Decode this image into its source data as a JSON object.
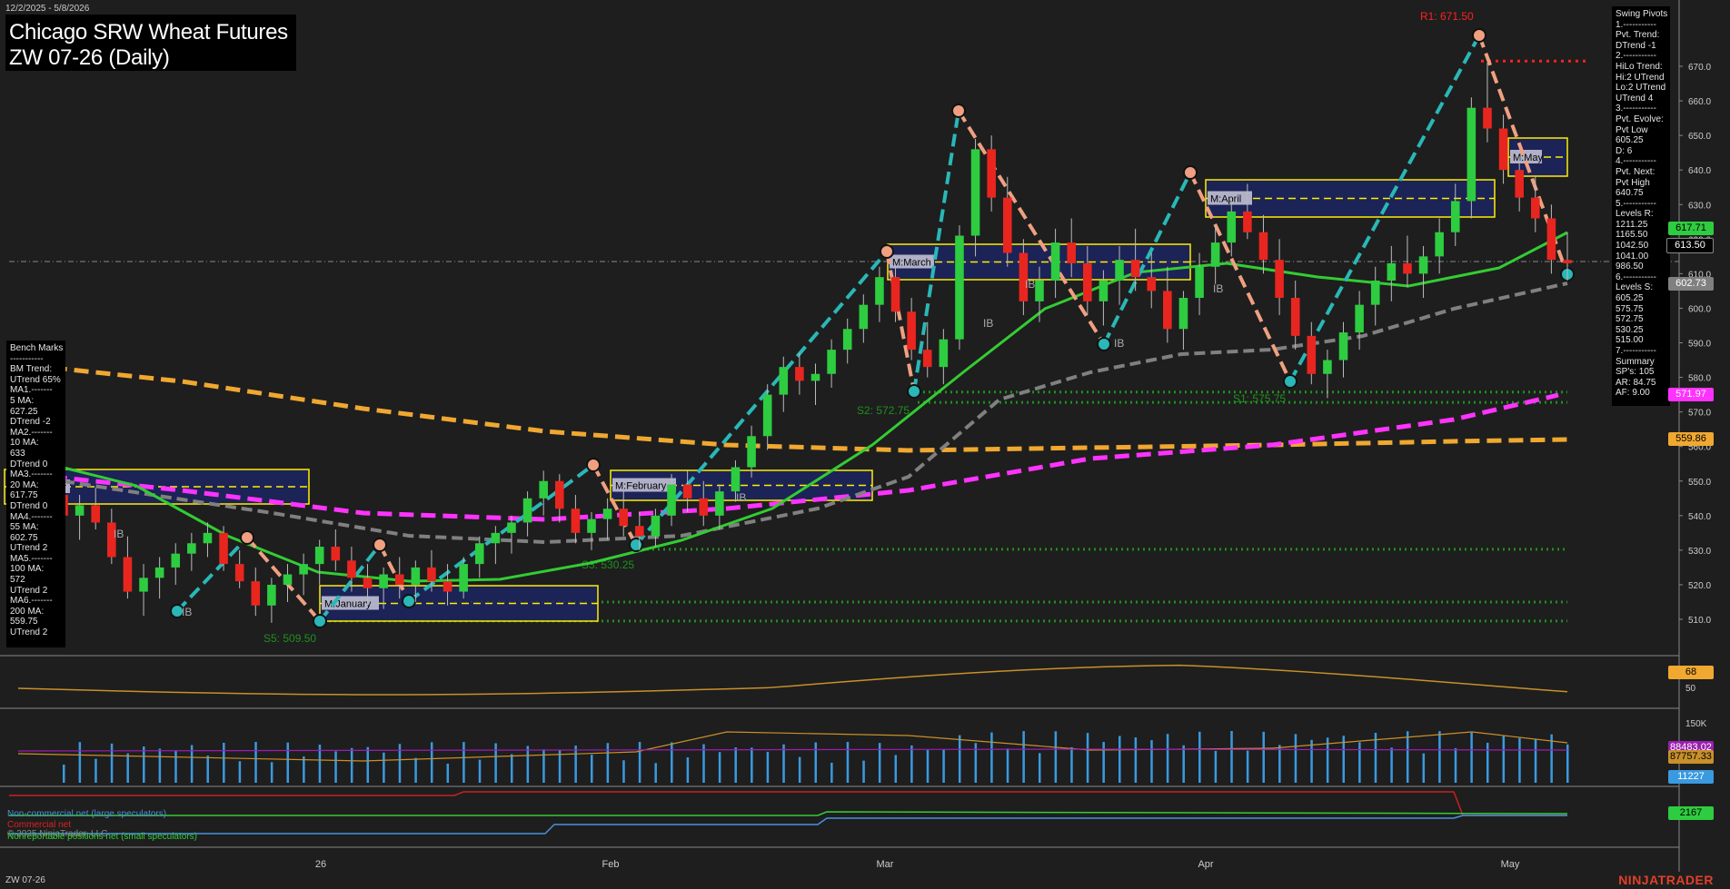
{
  "date_range": "12/2/2025 - 5/8/2026",
  "symbol_footer": "ZW 07-26",
  "brand": "NINJATRADER",
  "copyright": "© 2025 NinjaTrader, LLC",
  "title": {
    "line1": "Chicago SRW Wheat Futures",
    "line2": "ZW 07-26 (Daily)"
  },
  "benchmarks_text": "Bench Marks\n-----------\nBM Trend:\nUTrend 65%\nMA1.-------\n5 MA:\n627.25\nDTrend -2\nMA2.-------\n10 MA:\n633\nDTrend 0\nMA3.-------\n20 MA:\n617.75\nDTrend 0\nMA4.-------\n55 MA:\n602.75\nUTrend 2\nMA5.-------\n100 MA:\n572\nUTrend 2\nMA6.-------\n200 MA:\n559.75\nUTrend 2",
  "swing_text": "Swing Pivots\n1.-----------\nPvt. Trend:\nDTrend -1\n2.-----------\nHiLo Trend:\nHi:2 UTrend\nLo:2 UTrend\nUTrend 4\n3.-----------\nPvt. Evolve:\nPvt Low\n605.25\nD: 6\n4.-----------\nPvt. Next:\nPvt High\n640.75\n5.-----------\nLevels R:\n1211.25\n1165.50\n1042.50\n1041.00\n986.50\n6.-----------\nLevels S:\n605.25\n575.75\n572.75\n530.25\n515.00\n7.-----------\nSummary\nSP's: 105\nAR: 84.75\nAF: 9.00",
  "legend": {
    "noncommercial": "Non-commercial net (large speculators)",
    "commercial": "Commercial net",
    "nonreportable": "Nonreportable positions net (small speculators)"
  },
  "colors": {
    "background": "#1e1e1e",
    "up_candle": "#2ecc40",
    "down_candle": "#e8261f",
    "ma20": "#33cc33",
    "ma55": "#808080",
    "ma100": "#ff33ff",
    "ma200": "#f0a830",
    "swing_up": "#2ab7b7",
    "swing_down": "#f0a080",
    "support": "#1f8f1f",
    "resistance": "#ff2020",
    "volume": "#3a9ae0",
    "stoch": "#c8902a"
  },
  "price_tags": [
    {
      "value": "617.71",
      "bg": "#2ecc40",
      "fg": "#000"
    },
    {
      "value": "613.50",
      "bg": "#000000",
      "fg": "#fff"
    },
    {
      "value": "602.73",
      "bg": "#808080",
      "fg": "#fff"
    },
    {
      "value": "571.97",
      "bg": "#ff33ff",
      "fg": "#fff"
    },
    {
      "value": "559.86",
      "bg": "#f0a830",
      "fg": "#000"
    }
  ],
  "indicator_tags": [
    {
      "value": "68",
      "bg": "#f0a830",
      "fg": "#000"
    },
    {
      "value": "88483.02",
      "bg": "#9a1fb0",
      "fg": "#fff"
    },
    {
      "value": "87757.33",
      "bg": "#c8902a",
      "fg": "#000"
    },
    {
      "value": "11227",
      "bg": "#3a9ae0",
      "fg": "#fff"
    },
    {
      "value": "2167",
      "bg": "#2ecc40",
      "fg": "#000"
    }
  ],
  "chart_data": {
    "type": "candlestick",
    "title": "Chicago SRW Wheat Futures ZW 07-26 (Daily)",
    "x_labels": [
      "26",
      "Feb",
      "Mar",
      "Apr",
      "May"
    ],
    "ylim": [
      503,
      677
    ],
    "y_ticks": [
      510,
      520,
      530,
      540,
      550,
      560,
      570,
      580,
      590,
      600,
      610,
      620,
      630,
      640,
      650,
      660,
      670
    ],
    "candles": [
      [
        546,
        549,
        537,
        540
      ],
      [
        540,
        546,
        533,
        543
      ],
      [
        543,
        548,
        536,
        538
      ],
      [
        538,
        542,
        526,
        528
      ],
      [
        528,
        534,
        516,
        518
      ],
      [
        518,
        526,
        511,
        522
      ],
      [
        522,
        528,
        516,
        525
      ],
      [
        525,
        532,
        520,
        529
      ],
      [
        529,
        535,
        524,
        532
      ],
      [
        532,
        538,
        528,
        535
      ],
      [
        535,
        537,
        524,
        526
      ],
      [
        526,
        530,
        519,
        521
      ],
      [
        521,
        525,
        511,
        514
      ],
      [
        514,
        522,
        509,
        520
      ],
      [
        520,
        526,
        515,
        523
      ],
      [
        523,
        529,
        517,
        526
      ],
      [
        526,
        533,
        520,
        531
      ],
      [
        531,
        536,
        524,
        527
      ],
      [
        527,
        531,
        518,
        522
      ],
      [
        522,
        526,
        514,
        519
      ],
      [
        519,
        525,
        513,
        523
      ],
      [
        523,
        528,
        516,
        520
      ],
      [
        520,
        527,
        515,
        525
      ],
      [
        525,
        530,
        518,
        521
      ],
      [
        521,
        526,
        514,
        518
      ],
      [
        518,
        528,
        516,
        526
      ],
      [
        526,
        534,
        522,
        532
      ],
      [
        532,
        537,
        526,
        535
      ],
      [
        535,
        540,
        529,
        538
      ],
      [
        538,
        547,
        534,
        545
      ],
      [
        545,
        553,
        540,
        550
      ],
      [
        550,
        552,
        538,
        542
      ],
      [
        542,
        546,
        532,
        535
      ],
      [
        535,
        541,
        530,
        539
      ],
      [
        539,
        545,
        533,
        542
      ],
      [
        542,
        547,
        534,
        537
      ],
      [
        537,
        541,
        530,
        534
      ],
      [
        534,
        542,
        531,
        540
      ],
      [
        540,
        552,
        537,
        549
      ],
      [
        549,
        553,
        541,
        545
      ],
      [
        545,
        550,
        537,
        540
      ],
      [
        540,
        549,
        536,
        547
      ],
      [
        547,
        556,
        544,
        554
      ],
      [
        554,
        566,
        551,
        563
      ],
      [
        563,
        578,
        559,
        575
      ],
      [
        575,
        586,
        570,
        583
      ],
      [
        583,
        587,
        575,
        579
      ],
      [
        579,
        584,
        572,
        581
      ],
      [
        581,
        591,
        577,
        588
      ],
      [
        588,
        597,
        584,
        594
      ],
      [
        594,
        604,
        590,
        601
      ],
      [
        601,
        612,
        596,
        609
      ],
      [
        609,
        612,
        596,
        599
      ],
      [
        599,
        603,
        585,
        588
      ],
      [
        588,
        596,
        580,
        583
      ],
      [
        583,
        594,
        578,
        591
      ],
      [
        591,
        624,
        588,
        621
      ],
      [
        621,
        649,
        615,
        646
      ],
      [
        646,
        650,
        628,
        632
      ],
      [
        632,
        638,
        612,
        616
      ],
      [
        616,
        620,
        598,
        602
      ],
      [
        602,
        612,
        596,
        608
      ],
      [
        608,
        623,
        603,
        619
      ],
      [
        619,
        626,
        609,
        613
      ],
      [
        613,
        618,
        598,
        602
      ],
      [
        602,
        611,
        595,
        608
      ],
      [
        608,
        618,
        601,
        614
      ],
      [
        614,
        623,
        605,
        609
      ],
      [
        609,
        616,
        600,
        605
      ],
      [
        605,
        612,
        590,
        594
      ],
      [
        594,
        605,
        588,
        603
      ],
      [
        603,
        616,
        598,
        612
      ],
      [
        612,
        624,
        607,
        619
      ],
      [
        619,
        632,
        615,
        628
      ],
      [
        628,
        636,
        620,
        622
      ],
      [
        622,
        627,
        610,
        614
      ],
      [
        614,
        620,
        598,
        603
      ],
      [
        603,
        608,
        588,
        592
      ],
      [
        592,
        596,
        578,
        581
      ],
      [
        581,
        588,
        574,
        585
      ],
      [
        585,
        596,
        580,
        593
      ],
      [
        593,
        605,
        588,
        601
      ],
      [
        601,
        612,
        595,
        608
      ],
      [
        608,
        618,
        602,
        613
      ],
      [
        613,
        621,
        606,
        610
      ],
      [
        610,
        618,
        603,
        615
      ],
      [
        615,
        626,
        610,
        622
      ],
      [
        622,
        636,
        618,
        631
      ],
      [
        631,
        661,
        626,
        658
      ],
      [
        658,
        671,
        648,
        652
      ],
      [
        652,
        656,
        636,
        640
      ],
      [
        640,
        644,
        628,
        632
      ],
      [
        632,
        638,
        622,
        626
      ],
      [
        626,
        630,
        610,
        614
      ],
      [
        614,
        622,
        608,
        613
      ]
    ]
  }
}
